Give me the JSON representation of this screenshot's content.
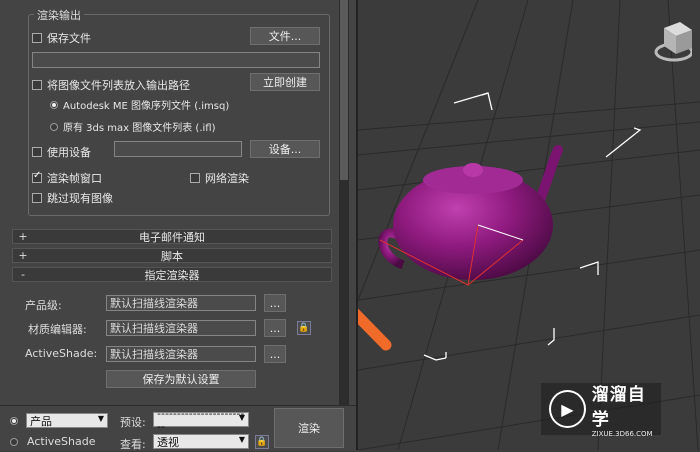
{
  "render_output": {
    "group_title": "渲染输出",
    "save_file_label": "保存文件",
    "files_button": "文件...",
    "add_to_output_path_label": "将图像文件列表放入输出路径",
    "create_now_button": "立即创建",
    "imsq_label": "Autodesk ME 图像序列文件 (.imsq)",
    "ifl_label": "原有 3ds max 图像文件列表 (.ifl)",
    "use_device_label": "使用设备",
    "devices_button": "设备...",
    "render_frame_window_label": "渲染帧窗口",
    "net_render_label": "网络渲染",
    "skip_existing_label": "跳过现有图像"
  },
  "rollouts": {
    "email": "电子邮件通知",
    "scripts": "脚本",
    "assign_renderer": "指定渲染器",
    "plus": "+",
    "minus": "-"
  },
  "assign_renderer": {
    "production_label": "产品级:",
    "production_value": "默认扫描线渲染器",
    "material_editor_label": "材质编辑器:",
    "material_editor_value": "默认扫描线渲染器",
    "activeshade_label": "ActiveShade:",
    "activeshade_value": "默认扫描线渲染器",
    "browse": "...",
    "save_default_button": "保存为默认设置"
  },
  "bottom_bar": {
    "production_radio": "产品",
    "activeshade_radio": "ActiveShade",
    "preset_label": "预设:",
    "preset_value": "------------------------",
    "view_label": "查看:",
    "view_value": "透视",
    "render_button": "渲染"
  },
  "watermark": {
    "logo_glyph": "▶",
    "name": "溜溜自学",
    "url": "ZIXUE.3D66.COM"
  },
  "colors": {
    "teapot": "#8e1a7e",
    "arrow": "#f06a2a"
  }
}
